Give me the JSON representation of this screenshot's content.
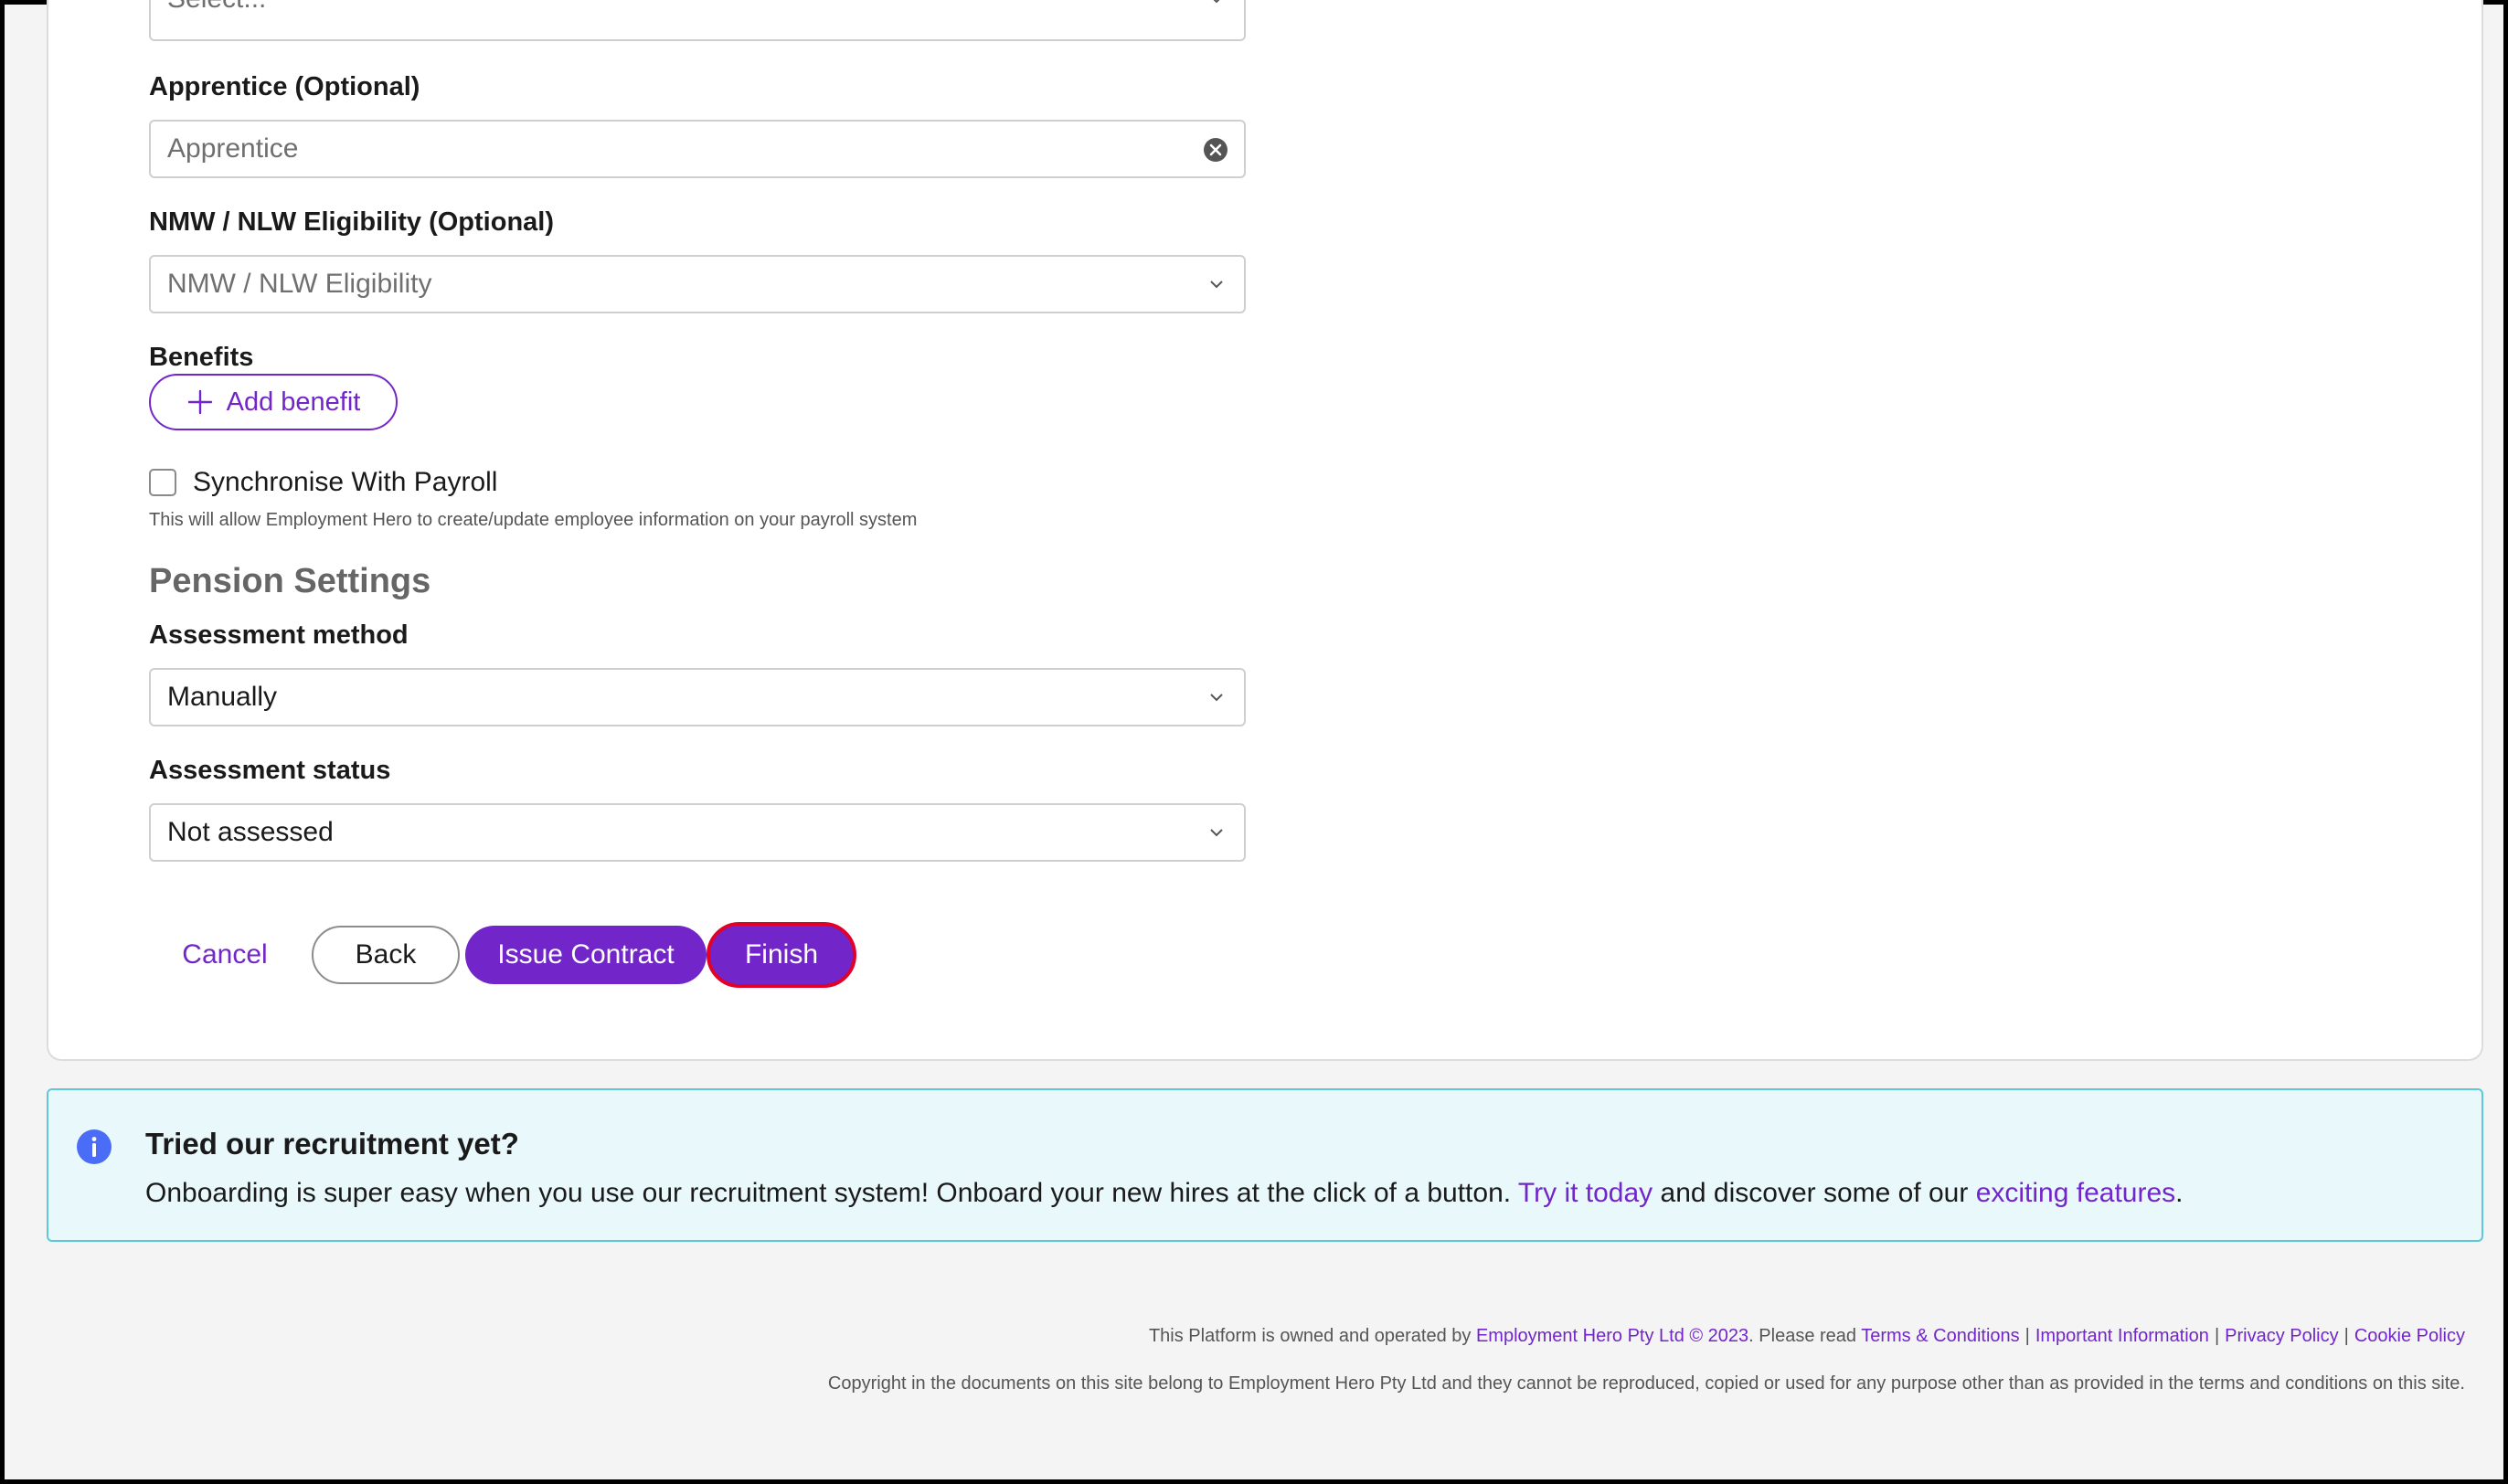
{
  "form": {
    "top_select_placeholder": "Select...",
    "apprentice": {
      "label": "Apprentice (Optional)",
      "placeholder": "Apprentice"
    },
    "nmw": {
      "label": "NMW / NLW Eligibility (Optional)",
      "placeholder": "NMW / NLW Eligibility"
    },
    "benefits": {
      "label": "Benefits",
      "add_label": "Add benefit"
    },
    "sync": {
      "label": "Synchronise With Payroll",
      "helper": "This will allow Employment Hero to create/update employee information on your payroll system",
      "checked": false
    },
    "pension": {
      "title": "Pension Settings",
      "assessment_method": {
        "label": "Assessment method",
        "value": "Manually"
      },
      "assessment_status": {
        "label": "Assessment status",
        "value": "Not assessed"
      }
    },
    "actions": {
      "cancel": "Cancel",
      "back": "Back",
      "issue_contract": "Issue Contract",
      "finish": "Finish"
    }
  },
  "banner": {
    "title": "Tried our recruitment yet?",
    "text_before": "Onboarding is super easy when you use our recruitment system! Onboard your new hires at the click of a button.",
    "link_try": "Try it today",
    "text_middle": "and discover some of our",
    "link_features": "exciting features",
    "text_end": "."
  },
  "footer": {
    "owned_prefix": "This Platform is owned and operated by",
    "company_link": "Employment Hero Pty Ltd © 2023",
    "please_read": ". Please read",
    "links": [
      "Terms & Conditions",
      "Important Information",
      "Privacy Policy",
      "Cookie Policy"
    ],
    "separator": "|",
    "copyright": "Copyright in the documents on this site belong to Employment Hero Pty Ltd and they cannot be reproduced, copied or used for any purpose other than as provided in the terms and conditions on this site."
  },
  "colors": {
    "accent": "#7226c9",
    "finish_highlight": "#e0002a",
    "info_blue": "#4a6cf7",
    "banner_bg": "#e8f8fb",
    "banner_border": "#5ec9d6"
  }
}
